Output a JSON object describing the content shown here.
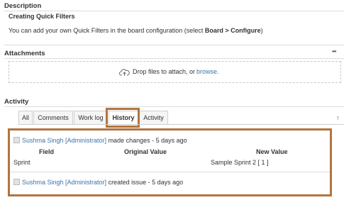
{
  "description": {
    "heading": "Description",
    "title": "Creating Quick Filters",
    "text_prefix": "You can add your own Quick Filters in the board configuration (select ",
    "text_bold": "Board > Configure",
    "text_suffix": ")"
  },
  "attachments": {
    "heading": "Attachments",
    "more": "•••",
    "drop_text": "Drop files to attach, or ",
    "browse_link": "browse."
  },
  "activity": {
    "heading": "Activity",
    "tabs": [
      {
        "label": "All"
      },
      {
        "label": "Comments"
      },
      {
        "label": "Work log"
      },
      {
        "label": "History",
        "active": true
      },
      {
        "label": "Activity"
      }
    ],
    "history": [
      {
        "user": "Sushma Singh [Administrator]",
        "action": " made changes - 5 days ago",
        "columns": {
          "field": "Field",
          "original": "Original Value",
          "new": "New Value"
        },
        "row": {
          "field": "Sprint",
          "original": "",
          "new": "Sample Sprint 2 [ 1 ]"
        }
      },
      {
        "user": "Sushma Singh [Administrator]",
        "action": " created issue - 5 days ago"
      }
    ]
  },
  "colors": {
    "highlight": "#b3743d",
    "link": "#3b73af"
  }
}
